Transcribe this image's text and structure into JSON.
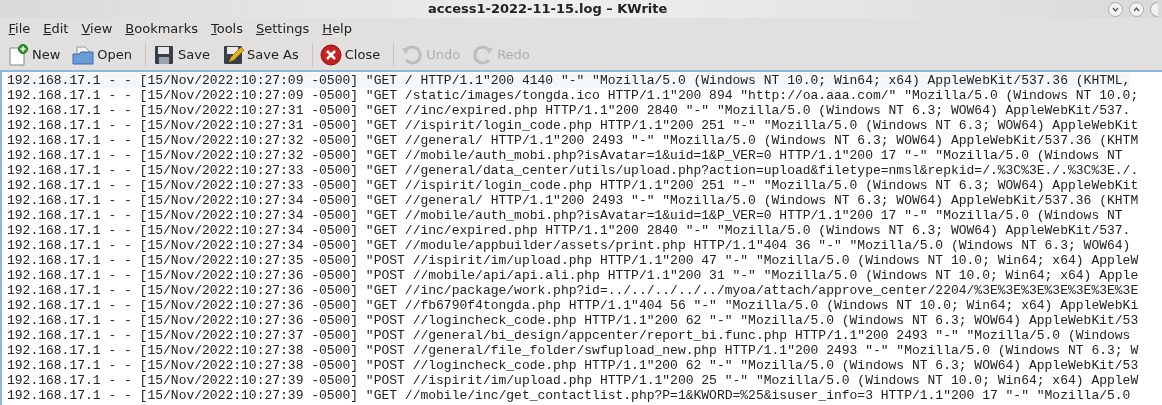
{
  "window": {
    "title": "access1-2022-11-15.log – KWrite"
  },
  "menu": [
    "File",
    "Edit",
    "View",
    "Bookmarks",
    "Tools",
    "Settings",
    "Help"
  ],
  "toolbar": [
    {
      "kind": "new",
      "label": "New",
      "disabled": false
    },
    {
      "kind": "open",
      "label": "Open",
      "disabled": false
    },
    {
      "kind": "separator"
    },
    {
      "kind": "save",
      "label": "Save",
      "disabled": false
    },
    {
      "kind": "saveas",
      "label": "Save As",
      "disabled": false
    },
    {
      "kind": "separator"
    },
    {
      "kind": "close",
      "label": "Close",
      "disabled": false
    },
    {
      "kind": "separator"
    },
    {
      "kind": "undo",
      "label": "Undo",
      "disabled": true
    },
    {
      "kind": "redo",
      "label": "Redo",
      "disabled": true
    }
  ],
  "editor": {
    "lines": [
      "192.168.17.1 - - [15/Nov/2022:10:27:09 -0500] \"GET / HTTP/1.1\"200 4140 \"-\" \"Mozilla/5.0 (Windows NT 10.0; Win64; x64) AppleWebKit/537.36 (KHTML,",
      "192.168.17.1 - - [15/Nov/2022:10:27:09 -0500] \"GET /static/images/tongda.ico HTTP/1.1\"200 894 \"http://oa.aaa.com/\" \"Mozilla/5.0 (Windows NT 10.0;",
      "192.168.17.1 - - [15/Nov/2022:10:27:31 -0500] \"GET //inc/expired.php HTTP/1.1\"200 2840 \"-\" \"Mozilla/5.0 (Windows NT 6.3; WOW64) AppleWebKit/537.",
      "192.168.17.1 - - [15/Nov/2022:10:27:31 -0500] \"GET //ispirit/login_code.php HTTP/1.1\"200 251 \"-\" \"Mozilla/5.0 (Windows NT 6.3; WOW64) AppleWebKit",
      "192.168.17.1 - - [15/Nov/2022:10:27:32 -0500] \"GET //general/ HTTP/1.1\"200 2493 \"-\" \"Mozilla/5.0 (Windows NT 6.3; WOW64) AppleWebKit/537.36 (KHTM",
      "192.168.17.1 - - [15/Nov/2022:10:27:32 -0500] \"GET //mobile/auth_mobi.php?isAvatar=1&uid=1&P_VER=0 HTTP/1.1\"200 17 \"-\" \"Mozilla/5.0 (Windows NT",
      "192.168.17.1 - - [15/Nov/2022:10:27:33 -0500] \"GET //general/data_center/utils/upload.php?action=upload&filetype=nmsl&repkid=/.%3C%3E./.%3C%3E./.",
      "192.168.17.1 - - [15/Nov/2022:10:27:33 -0500] \"GET //ispirit/login_code.php HTTP/1.1\"200 251 \"-\" \"Mozilla/5.0 (Windows NT 6.3; WOW64) AppleWebKit",
      "192.168.17.1 - - [15/Nov/2022:10:27:34 -0500] \"GET //general/ HTTP/1.1\"200 2493 \"-\" \"Mozilla/5.0 (Windows NT 6.3; WOW64) AppleWebKit/537.36 (KHTM",
      "192.168.17.1 - - [15/Nov/2022:10:27:34 -0500] \"GET //mobile/auth_mobi.php?isAvatar=1&uid=1&P_VER=0 HTTP/1.1\"200 17 \"-\" \"Mozilla/5.0 (Windows NT",
      "192.168.17.1 - - [15/Nov/2022:10:27:34 -0500] \"GET //inc/expired.php HTTP/1.1\"200 2840 \"-\" \"Mozilla/5.0 (Windows NT 6.3; WOW64) AppleWebKit/537.",
      "192.168.17.1 - - [15/Nov/2022:10:27:34 -0500] \"GET //module/appbuilder/assets/print.php HTTP/1.1\"404 36 \"-\" \"Mozilla/5.0 (Windows NT 6.3; WOW64)",
      "192.168.17.1 - - [15/Nov/2022:10:27:35 -0500] \"POST //ispirit/im/upload.php HTTP/1.1\"200 47 \"-\" \"Mozilla/5.0 (Windows NT 10.0; Win64; x64) AppleW",
      "192.168.17.1 - - [15/Nov/2022:10:27:36 -0500] \"POST //mobile/api/api.ali.php HTTP/1.1\"200 31 \"-\" \"Mozilla/5.0 (Windows NT 10.0; Win64; x64) Apple",
      "192.168.17.1 - - [15/Nov/2022:10:27:36 -0500] \"GET //inc/package/work.php?id=../../../../../myoa/attach/approve_center/2204/%3E%3E%3E%3E%3E%3E%3E",
      "192.168.17.1 - - [15/Nov/2022:10:27:36 -0500] \"GET //fb6790f4tongda.php HTTP/1.1\"404 56 \"-\" \"Mozilla/5.0 (Windows NT 10.0; Win64; x64) AppleWebKi",
      "192.168.17.1 - - [15/Nov/2022:10:27:36 -0500] \"POST //logincheck_code.php HTTP/1.1\"200 62 \"-\" \"Mozilla/5.0 (Windows NT 6.3; WOW64) AppleWebKit/53",
      "192.168.17.1 - - [15/Nov/2022:10:27:37 -0500] \"POST //general/bi_design/appcenter/report_bi.func.php HTTP/1.1\"200 2493 \"-\" \"Mozilla/5.0 (Windows",
      "192.168.17.1 - - [15/Nov/2022:10:27:38 -0500] \"POST //general/file_folder/swfupload_new.php HTTP/1.1\"200 2493 \"-\" \"Mozilla/5.0 (Windows NT 6.3; W",
      "192.168.17.1 - - [15/Nov/2022:10:27:38 -0500] \"POST //logincheck_code.php HTTP/1.1\"200 62 \"-\" \"Mozilla/5.0 (Windows NT 6.3; WOW64) AppleWebKit/53",
      "192.168.17.1 - - [15/Nov/2022:10:27:39 -0500] \"POST //ispirit/im/upload.php HTTP/1.1\"200 25 \"-\" \"Mozilla/5.0 (Windows NT 10.0; Win64; x64) AppleW",
      "192.168.17.1 - - [15/Nov/2022:10:27:39 -0500] \"GET //mobile/inc/get_contactlist.php?P=1&KWORD=%25&isuser_info=3 HTTP/1.1\"200 17 \"-\" \"Mozilla/5.0"
    ]
  }
}
